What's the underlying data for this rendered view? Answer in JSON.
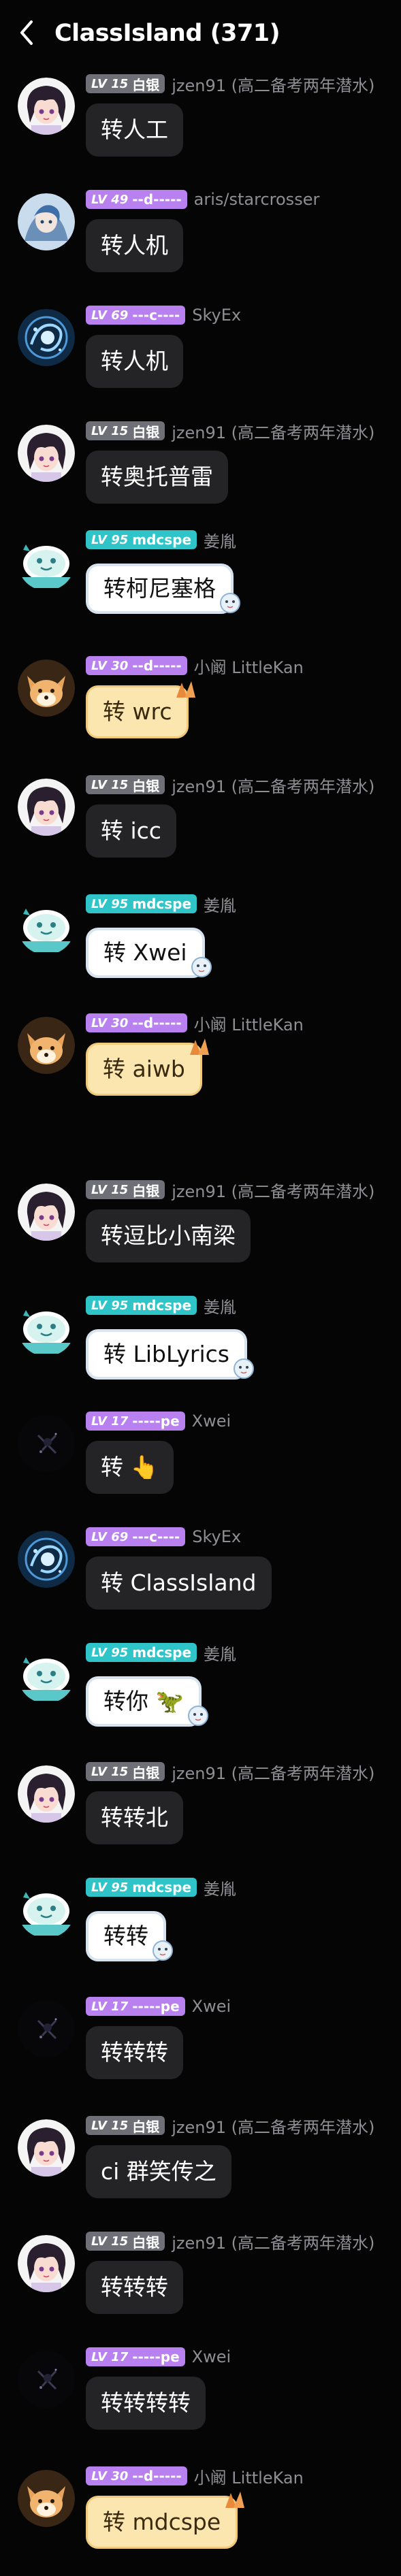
{
  "header": {
    "title": "ClassIsland (371)"
  },
  "colors": {
    "badge_grey": "#6f6f78",
    "badge_purple": "#b981f0",
    "badge_teal": "#2fc4c8",
    "bubble": "#242426",
    "background": "#050506"
  },
  "messages": [
    {
      "level": "LV 15",
      "tag": "白银",
      "nick": "jzen91 (高二备考两年潜水)",
      "text": "转人工",
      "avatar": "anime-avatar-icon",
      "badge": "grey"
    },
    {
      "level": "LV 49",
      "tag": "--d-----",
      "nick": "aris/starcrosser",
      "text": "转人机",
      "avatar": "blue-character-avatar-icon",
      "badge": "purple"
    },
    {
      "level": "LV 69",
      "tag": "---c----",
      "nick": "SkyEx",
      "text": "转人机",
      "avatar": "blue-swirl-avatar-icon",
      "badge": "purple"
    },
    {
      "level": "LV 15",
      "tag": "白银",
      "nick": "jzen91 (高二备考两年潜水)",
      "text": "转奥托普雷",
      "avatar": "anime-avatar-icon",
      "badge": "grey"
    },
    {
      "level": "LV 95",
      "tag": "mdcspe",
      "nick": "姜胤",
      "text": "转柯尼塞格",
      "avatar": "cartoon-avatar-icon",
      "badge": "teal"
    },
    {
      "level": "LV 30",
      "tag": "--d-----",
      "nick": "小阚 LittleKan",
      "text": "转 wrc",
      "avatar": "fox-avatar-icon",
      "badge": "purple"
    },
    {
      "level": "LV 15",
      "tag": "白银",
      "nick": "jzen91 (高二备考两年潜水)",
      "text": "转 icc",
      "avatar": "anime-avatar-icon",
      "badge": "grey"
    },
    {
      "level": "LV 95",
      "tag": "mdcspe",
      "nick": "姜胤",
      "text": "转 Xwei",
      "avatar": "cartoon-avatar-icon",
      "badge": "teal"
    },
    {
      "level": "LV 30",
      "tag": "--d-----",
      "nick": "小阚 LittleKan",
      "text": "转 aiwb",
      "avatar": "fox-avatar-icon",
      "badge": "purple"
    },
    {
      "level": "LV 15",
      "tag": "白银",
      "nick": "jzen91 (高二备考两年潜水)",
      "text": "转逗比小南梁",
      "avatar": "anime-avatar-icon",
      "badge": "grey"
    },
    {
      "level": "LV 95",
      "tag": "mdcspe",
      "nick": "姜胤",
      "text": "转 LibLyrics",
      "avatar": "cartoon-avatar-icon",
      "badge": "teal"
    },
    {
      "level": "LV 17",
      "tag": "-----pe",
      "nick": "Xwei",
      "text": "转 👆",
      "avatar": "dark-avatar-icon",
      "badge": "purple"
    },
    {
      "level": "LV 69",
      "tag": "---c----",
      "nick": "SkyEx",
      "text": "转 ClassIsland",
      "avatar": "blue-swirl-avatar-icon",
      "badge": "purple"
    },
    {
      "level": "LV 95",
      "tag": "mdcspe",
      "nick": "姜胤",
      "text": "转你 🦖",
      "avatar": "cartoon-avatar-icon",
      "badge": "teal"
    },
    {
      "level": "LV 15",
      "tag": "白银",
      "nick": "jzen91 (高二备考两年潜水)",
      "text": "转转北",
      "avatar": "anime-avatar-icon",
      "badge": "grey"
    },
    {
      "level": "LV 95",
      "tag": "mdcspe",
      "nick": "姜胤",
      "text": "转转",
      "avatar": "cartoon-avatar-icon",
      "badge": "teal"
    },
    {
      "level": "LV 17",
      "tag": "-----pe",
      "nick": "Xwei",
      "text": "转转转",
      "avatar": "dark-avatar-icon",
      "badge": "purple"
    },
    {
      "level": "LV 15",
      "tag": "白银",
      "nick": "jzen91 (高二备考两年潜水)",
      "text": "ci 群笑传之",
      "avatar": "anime-avatar-icon",
      "badge": "grey"
    },
    {
      "level": "LV 15",
      "tag": "白银",
      "nick": "jzen91 (高二备考两年潜水)",
      "text": "转转转",
      "avatar": "anime-avatar-icon",
      "badge": "grey"
    },
    {
      "level": "LV 17",
      "tag": "-----pe",
      "nick": "Xwei",
      "text": "转转转转",
      "avatar": "dark-avatar-icon",
      "badge": "purple"
    },
    {
      "level": "LV 30",
      "tag": "--d-----",
      "nick": "小阚 LittleKan",
      "text": "转 mdcspe",
      "avatar": "fox-avatar-icon",
      "badge": "purple"
    }
  ]
}
